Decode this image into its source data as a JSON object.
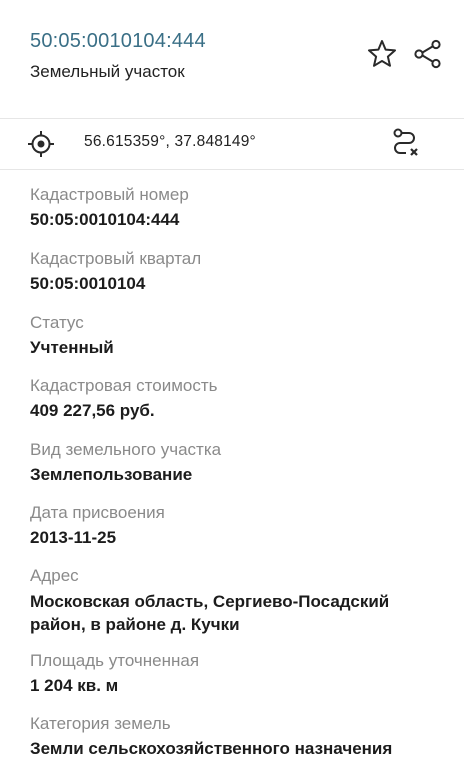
{
  "header": {
    "cadastral_id": "50:05:0010104:444",
    "object_type": "Земельный участок",
    "icons": {
      "favorite": "star-icon",
      "share": "share-icon"
    }
  },
  "location": {
    "coordinates": "56.615359°, 37.848149°",
    "icons": {
      "locate": "crosshair-icon",
      "route": "route-icon"
    }
  },
  "fields": {
    "cadastral_number": {
      "label": "Кадастровый номер",
      "value": "50:05:0010104:444"
    },
    "cadastral_quarter": {
      "label": "Кадастровый квартал",
      "value": "50:05:0010104"
    },
    "status": {
      "label": "Статус",
      "value": "Учтенный"
    },
    "cadastral_cost": {
      "label": "Кадастровая стоимость",
      "value": "409 227,56 руб."
    },
    "land_use_type": {
      "label": "Вид земельного участка",
      "value": "Землепользование"
    },
    "assignment_date": {
      "label": "Дата присвоения",
      "value": "2013-11-25"
    },
    "address": {
      "label": "Адрес",
      "value": "Московская область, Сергиево-Посадский район, в районе д. Кучки"
    },
    "area": {
      "label": "Площадь уточненная",
      "value": "1 204 кв. м"
    },
    "land_category": {
      "label": "Категория земель",
      "value": "Земли сельскохозяйственного назначения"
    }
  },
  "colors": {
    "title": "#3a6f86",
    "label": "#8a8a8a",
    "divider": "#e6e6e6"
  }
}
